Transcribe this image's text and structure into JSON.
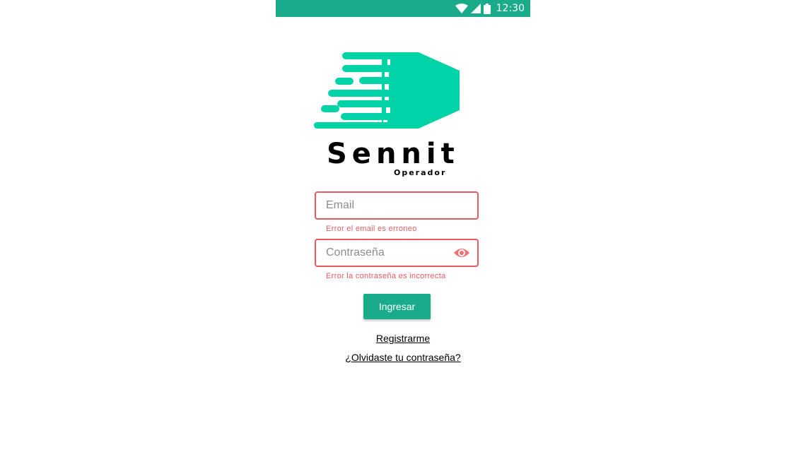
{
  "status_bar": {
    "time": "12:30",
    "icons": [
      "wifi-icon",
      "signal-icon",
      "battery-icon"
    ],
    "background": "#1aab8a"
  },
  "brand": {
    "name": "Sennit",
    "subtitle": "Operador",
    "logo_color": "#00d4a6"
  },
  "form": {
    "email": {
      "placeholder": "Email",
      "value": "",
      "error": "Error el email es erroneo"
    },
    "password": {
      "placeholder": "Contraseña",
      "value": "",
      "error": "Error la contraseña es incorrecta",
      "toggle_icon": "eye-icon"
    },
    "submit_label": "Ingresar",
    "error_color": "#e85a5f"
  },
  "links": {
    "register": "Registrarme",
    "forgot_password": "¿Olvidaste tu contraseña?"
  }
}
